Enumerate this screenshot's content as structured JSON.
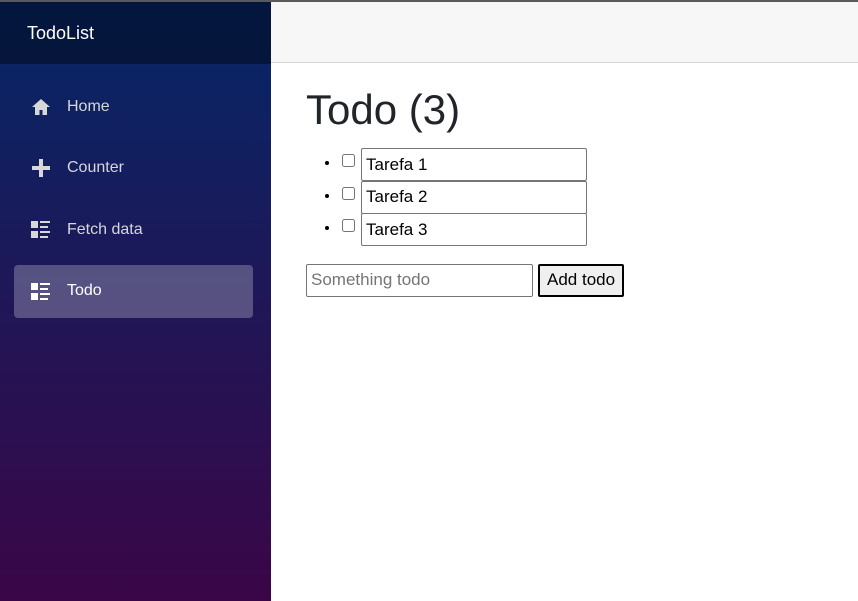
{
  "app": {
    "brand": "TodoList"
  },
  "nav": {
    "items": [
      {
        "label": "Home",
        "icon": "home-icon",
        "active": false
      },
      {
        "label": "Counter",
        "icon": "plus-icon",
        "active": false
      },
      {
        "label": "Fetch data",
        "icon": "list-rich-icon",
        "active": false
      },
      {
        "label": "Todo",
        "icon": "list-rich-icon",
        "active": true
      }
    ]
  },
  "main": {
    "title": "Todo (3)",
    "todos": [
      {
        "title": "Tarefa 1",
        "done": false
      },
      {
        "title": "Tarefa 2",
        "done": false
      },
      {
        "title": "Tarefa 3",
        "done": false
      }
    ],
    "new_todo": {
      "value": "",
      "placeholder": "Something todo"
    },
    "add_button_label": "Add todo"
  },
  "colors": {
    "sidebar_top": "#052767",
    "sidebar_bottom": "#3a0647",
    "top_row_bg": "#f7f7f7"
  }
}
